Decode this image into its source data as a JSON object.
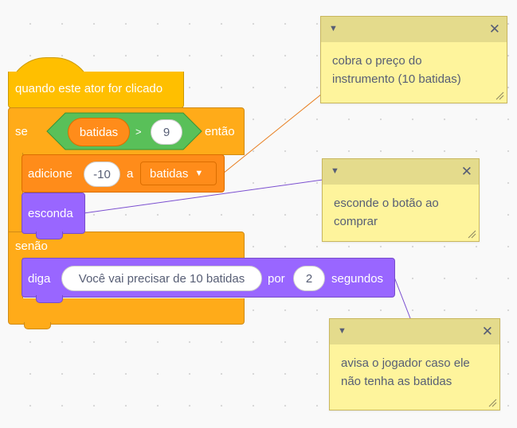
{
  "hat": {
    "label": "quando este ator for clicado"
  },
  "if_else": {
    "if_label": "se",
    "then_label": "então",
    "else_label": "senão",
    "condition": {
      "variable": "batidas",
      "operator": ">",
      "value": "9"
    }
  },
  "change_var": {
    "label": "adicione",
    "value": "-10",
    "to_label": "a",
    "variable": "batidas",
    "dropdown_icon": "chevron-down-icon"
  },
  "hide": {
    "label": "esconda"
  },
  "say": {
    "label": "diga",
    "message": "Você vai precisar de 10 batidas",
    "for_label": "por",
    "seconds": "2",
    "unit_label": "segundos"
  },
  "comments": [
    {
      "text_line1": "cobra o preço do",
      "text_line2": "instrumento (10 batidas)"
    },
    {
      "text_line1": "esconde o botão ao",
      "text_line2": "comprar"
    },
    {
      "text_line1": "avisa o jogador caso ele",
      "text_line2": "não tenha as batidas"
    }
  ],
  "colors": {
    "events": "#ffbf00",
    "control": "#ffab19",
    "operators": "#59c059",
    "variables": "#ff8c1a",
    "looks": "#9966ff",
    "comment": "#fef49c",
    "comment_header": "#e4db8c",
    "link_orange": "#e87d1e",
    "link_purple": "#7b4fd0"
  }
}
